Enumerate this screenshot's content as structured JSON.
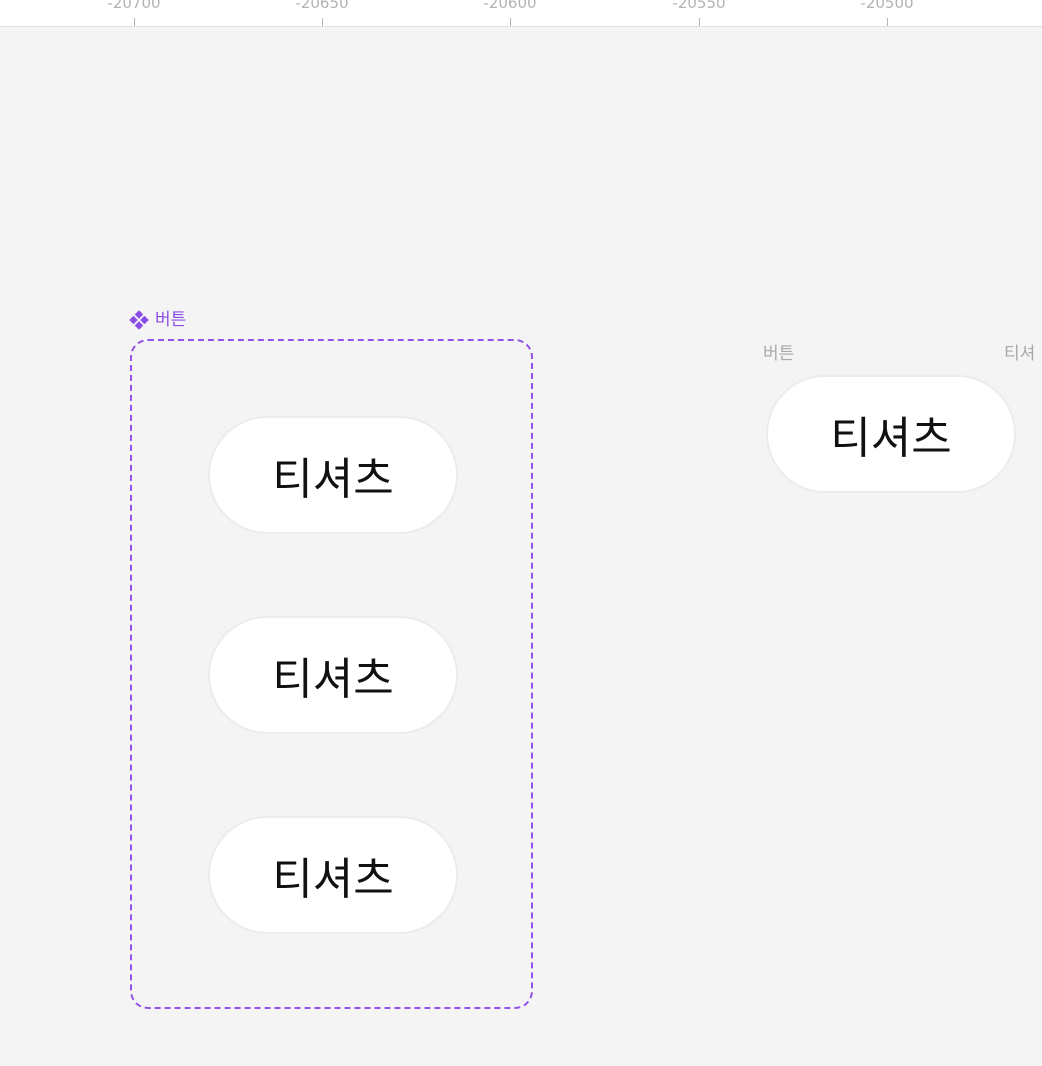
{
  "ruler": {
    "labels": [
      "-20700",
      "-20650",
      "-20600",
      "-20550",
      "-20500"
    ]
  },
  "component_set": {
    "label": "버튼",
    "icon": "component-set-icon",
    "accent_color": "#9353ea",
    "variants": [
      {
        "label": "티셔츠"
      },
      {
        "label": "티셔츠"
      },
      {
        "label": "티셔츠"
      }
    ]
  },
  "instance": {
    "frame_label": "버튼",
    "button_label": "티셔츠"
  },
  "clipped_frame": {
    "label": "티셔"
  }
}
